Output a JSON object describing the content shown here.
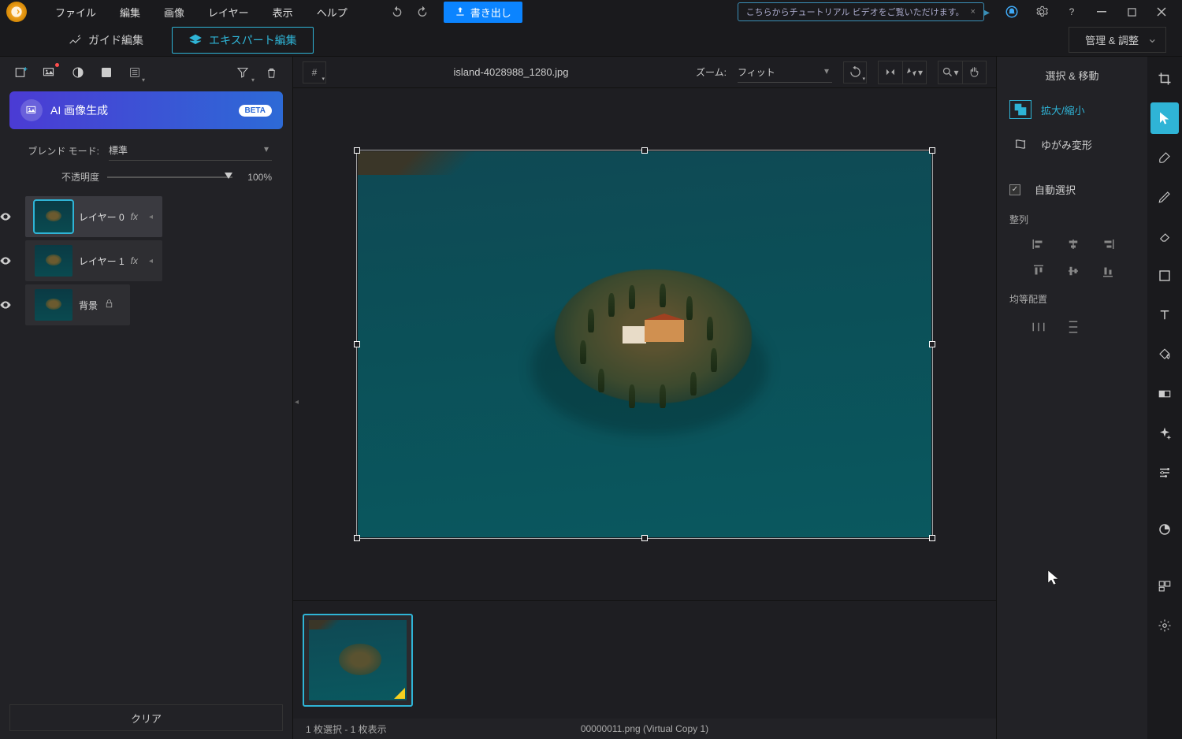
{
  "menubar": {
    "items": [
      "ファイル",
      "編集",
      "画像",
      "レイヤー",
      "表示",
      "ヘルプ"
    ],
    "export": "書き出し",
    "tutorial": "こちらからチュートリアル ビデオをご覧いただけます。"
  },
  "secondbar": {
    "guide": "ガイド編集",
    "expert": "エキスパート編集",
    "manage": "管理 & 調整"
  },
  "left": {
    "ai_banner": "AI 画像生成",
    "ai_badge": "BETA",
    "blend_label": "ブレンド モード:",
    "blend_value": "標準",
    "opacity_label": "不透明度",
    "opacity_value": "100%",
    "layers": [
      {
        "name": "レイヤー 0",
        "fx": true,
        "selected": true,
        "locked": false
      },
      {
        "name": "レイヤー 1",
        "fx": true,
        "selected": false,
        "locked": false
      },
      {
        "name": "背景",
        "fx": false,
        "selected": false,
        "locked": true
      }
    ],
    "clear": "クリア"
  },
  "canvas": {
    "filename": "island-4028988_1280.jpg",
    "zoom_label": "ズーム:",
    "zoom_value": "フィット"
  },
  "status": {
    "selection": "1 枚選択 - 1 枚表示",
    "file": "00000011.png (Virtual Copy 1)"
  },
  "right": {
    "title": "選択 & 移動",
    "scale": "拡大/縮小",
    "warp": "ゆがみ変形",
    "auto_select": "自動選択",
    "align": "整列",
    "distribute": "均等配置"
  }
}
